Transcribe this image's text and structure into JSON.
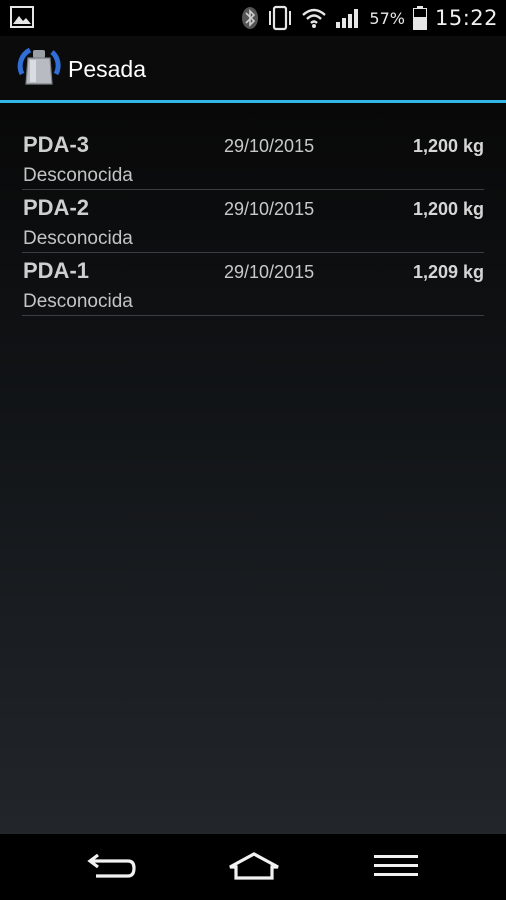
{
  "status_bar": {
    "battery_percent": "57%",
    "time": "15:22",
    "icons": [
      "image-icon",
      "bluetooth-icon",
      "vibrate-icon",
      "wifi-icon",
      "signal-icon",
      "battery-icon"
    ]
  },
  "app": {
    "title": "Pesada",
    "accent_color": "#33b5e5",
    "icon": "weight-icon"
  },
  "list": {
    "items": [
      {
        "name": "PDA-3",
        "date": "29/10/2015",
        "weight": "1,200 kg",
        "status": "Desconocida"
      },
      {
        "name": "PDA-2",
        "date": "29/10/2015",
        "weight": "1,200 kg",
        "status": "Desconocida"
      },
      {
        "name": "PDA-1",
        "date": "29/10/2015",
        "weight": "1,209 kg",
        "status": "Desconocida"
      }
    ]
  },
  "nav_bar": {
    "buttons": [
      "back-icon",
      "home-icon",
      "menu-icon"
    ]
  }
}
